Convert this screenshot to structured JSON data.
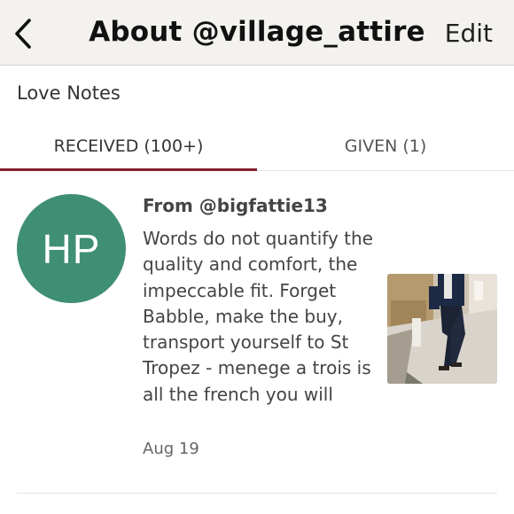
{
  "header": {
    "title": "About @village_attire",
    "edit_label": "Edit",
    "back_icon": "chevron-left-icon"
  },
  "section": {
    "title": "Love Notes"
  },
  "tabs": [
    {
      "label": "RECEIVED (100+)",
      "active": true
    },
    {
      "label": "GIVEN (1)",
      "active": false
    }
  ],
  "notes": [
    {
      "avatar_initials": "HP",
      "avatar_color": "#3f8f74",
      "from": "From @bigfattie13",
      "body": "Words do not quantify the quality and comfort, the impeccable fit. Forget Babble, make the buy, transport yourself to St Tropez - menege a trois is all the french you will",
      "date": "Aug 19"
    }
  ],
  "colors": {
    "accent": "#7f1f2a",
    "nav_background": "#f4f2ef"
  }
}
